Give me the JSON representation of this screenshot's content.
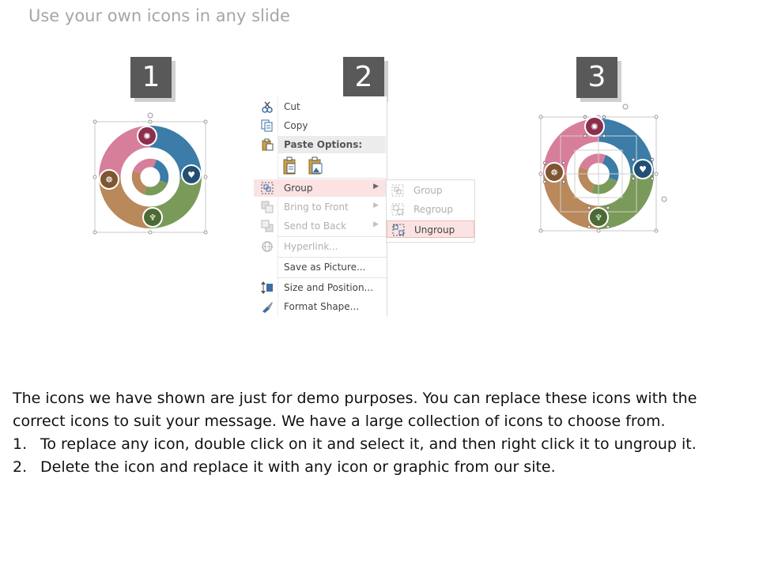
{
  "title": "Use your own icons in any slide",
  "steps": [
    "1",
    "2",
    "3"
  ],
  "colors": {
    "pink": "#D77E9A",
    "blue": "#3B7CA8",
    "green": "#7A9A5A",
    "brown": "#B9885B",
    "badge": "#595959",
    "highlight": "#FBE3E3"
  },
  "context_menu": {
    "items": [
      {
        "label": "Cut",
        "icon": "scissors-icon"
      },
      {
        "label": "Copy",
        "icon": "copy-icon"
      },
      {
        "label": "Paste Options:",
        "icon": "paste-icon"
      },
      {
        "label": "Group",
        "icon": "group-icon",
        "highlighted": true
      },
      {
        "label": "Bring to Front",
        "icon": "bring-front-icon",
        "disabled": true
      },
      {
        "label": "Send to Back",
        "icon": "send-back-icon",
        "disabled": true
      },
      {
        "label": "Hyperlink...",
        "icon": "hyperlink-icon",
        "disabled": true
      },
      {
        "label": "Save as Picture...",
        "icon": ""
      },
      {
        "label": "Size and Position...",
        "icon": "size-position-icon"
      },
      {
        "label": "Format Shape...",
        "icon": "format-shape-icon"
      }
    ],
    "submenu": [
      {
        "label": "Group",
        "icon": "group-icon",
        "disabled": true
      },
      {
        "label": "Regroup",
        "icon": "regroup-icon",
        "disabled": true
      },
      {
        "label": "Ungroup",
        "icon": "ungroup-icon",
        "highlighted": true
      }
    ]
  },
  "description": {
    "intro": "The icons we have shown are just for demo purposes. You can replace these icons with the correct icons to suit your message. We have a large collection of icons to choose from.",
    "steps": [
      {
        "num": "1.",
        "text": "To replace any icon, double click on it and select it, and then right click it to ungroup it."
      },
      {
        "num": "2.",
        "text": "Delete the icon and replace it with any icon or graphic from our site."
      }
    ]
  }
}
